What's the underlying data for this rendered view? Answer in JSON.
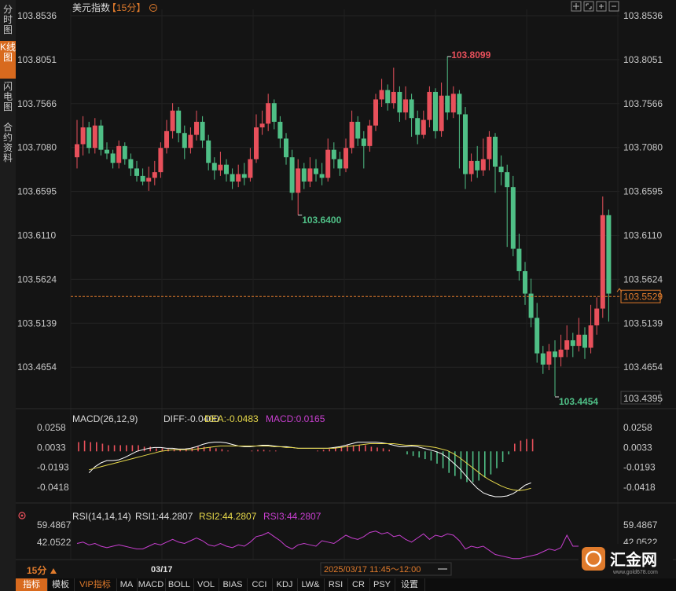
{
  "sidebar": {
    "tabs": [
      {
        "label": "分时图",
        "active": false
      },
      {
        "label": "K线图",
        "active": true
      },
      {
        "label": "闪电图",
        "active": false
      },
      {
        "label": "合约资料",
        "active": false
      }
    ]
  },
  "header": {
    "title": "美元指数",
    "period": "【15分】",
    "toolbar_icons": [
      "crosshair-icon",
      "expand-icon",
      "zoom-in-icon",
      "zoom-out-icon"
    ]
  },
  "price_axis": {
    "labels": [
      "103.8536",
      "103.8051",
      "103.7566",
      "103.7080",
      "103.6595",
      "103.6110",
      "103.5624",
      "103.5139",
      "103.4654"
    ],
    "current_price": "103.5529",
    "low_price_box": "103.4395"
  },
  "annotations": {
    "high": "103.8099",
    "low_mid": "103.6400",
    "low": "103.4454"
  },
  "macd": {
    "label": "MACD(26,12,9)",
    "diff": "DIFF:-0.0400",
    "dea": "DEA:-0.0483",
    "macd": "MACD:0.0165",
    "axis": [
      "0.0258",
      "0.0033",
      "-0.0193",
      "-0.0418"
    ]
  },
  "rsi": {
    "label": "RSI(14,14,14)",
    "rsi1": "RSI1:44.2807",
    "rsi2": "RSI2:44.2807",
    "rsi3": "RSI3:44.2807",
    "axis": [
      "59.4867",
      "42.0522"
    ]
  },
  "footer": {
    "period": "15分",
    "date_mark": "03/17",
    "time_range": "2025/03/17 11:45～12:00"
  },
  "indicator_tabs": [
    {
      "label": "指标",
      "active": true
    },
    {
      "label": "模板"
    },
    {
      "label": "VIP指标",
      "orange": true
    },
    {
      "label": "MA"
    },
    {
      "label": "MACD"
    },
    {
      "label": "BOLL"
    },
    {
      "label": "VOL"
    },
    {
      "label": "BIAS"
    },
    {
      "label": "CCI"
    },
    {
      "label": "KDJ"
    },
    {
      "label": "LW&"
    },
    {
      "label": "RSI"
    },
    {
      "label": "CR"
    },
    {
      "label": "PSY"
    },
    {
      "label": "设置"
    }
  ],
  "logo": {
    "text": "汇金网",
    "sub": "www.gold678.com"
  },
  "colors": {
    "up": "#e8505b",
    "down": "#4fbf86",
    "accent": "#e07b2c",
    "diff": "#ffffff",
    "dea": "#e6d84a",
    "macd": "#c83fd0",
    "rsi": "#c83fd0"
  },
  "chart_data": {
    "type": "candlestick",
    "candles": [
      [
        103.702,
        103.716,
        103.742,
        103.69
      ],
      [
        103.716,
        103.734,
        103.746,
        103.704
      ],
      [
        103.734,
        103.712,
        103.74,
        103.706
      ],
      [
        103.712,
        103.736,
        103.744,
        103.706
      ],
      [
        103.736,
        103.71,
        103.742,
        103.704
      ],
      [
        103.71,
        103.706,
        103.718,
        103.7
      ],
      [
        103.706,
        103.696,
        103.71,
        103.69
      ],
      [
        103.696,
        103.714,
        103.72,
        103.69
      ],
      [
        103.714,
        103.7,
        103.718,
        103.694
      ],
      [
        103.7,
        103.69,
        103.706,
        103.682
      ],
      [
        103.69,
        103.682,
        103.698,
        103.676
      ],
      [
        103.682,
        103.676,
        103.69,
        103.672
      ],
      [
        103.676,
        103.68,
        103.692,
        103.666
      ],
      [
        103.68,
        103.686,
        103.698,
        103.672
      ],
      [
        103.686,
        103.712,
        103.718,
        103.68
      ],
      [
        103.712,
        103.73,
        103.742,
        103.706
      ],
      [
        103.73,
        103.752,
        103.76,
        103.722
      ],
      [
        103.752,
        103.728,
        103.756,
        103.718
      ],
      [
        103.728,
        103.712,
        103.736,
        103.7
      ],
      [
        103.712,
        103.726,
        103.734,
        103.706
      ],
      [
        103.726,
        103.74,
        103.752,
        103.72
      ],
      [
        103.74,
        103.72,
        103.746,
        103.712
      ],
      [
        103.72,
        103.696,
        103.726,
        103.688
      ],
      [
        103.696,
        103.688,
        103.702,
        103.678
      ],
      [
        103.688,
        103.694,
        103.708,
        103.682
      ],
      [
        103.694,
        103.684,
        103.7,
        103.676
      ],
      [
        103.684,
        103.676,
        103.69,
        103.668
      ],
      [
        103.676,
        103.684,
        103.694,
        103.67
      ],
      [
        103.684,
        103.68,
        103.696,
        103.672
      ],
      [
        103.68,
        103.7,
        103.712,
        103.676
      ],
      [
        103.7,
        103.734,
        103.748,
        103.696
      ],
      [
        103.734,
        103.738,
        103.752,
        103.726
      ],
      [
        103.738,
        103.76,
        103.77,
        103.73
      ],
      [
        103.76,
        103.74,
        103.764,
        103.732
      ],
      [
        103.74,
        103.722,
        103.746,
        103.712
      ],
      [
        103.722,
        103.702,
        103.728,
        103.694
      ],
      [
        103.702,
        103.664,
        103.71,
        103.656
      ],
      [
        103.664,
        103.69,
        103.7,
        103.64
      ],
      [
        103.69,
        103.676,
        103.696,
        103.668
      ],
      [
        103.676,
        103.69,
        103.702,
        103.67
      ],
      [
        103.69,
        103.684,
        103.7,
        103.676
      ],
      [
        103.684,
        103.68,
        103.696,
        103.672
      ],
      [
        103.68,
        103.71,
        103.722,
        103.676
      ],
      [
        103.71,
        103.7,
        103.718,
        103.69
      ],
      [
        103.7,
        103.69,
        103.708,
        103.682
      ],
      [
        103.69,
        103.712,
        103.722,
        103.686
      ],
      [
        103.712,
        103.74,
        103.752,
        103.706
      ],
      [
        103.74,
        103.722,
        103.746,
        103.714
      ],
      [
        103.722,
        103.714,
        103.73,
        103.69
      ],
      [
        103.714,
        103.736,
        103.742,
        103.708
      ],
      [
        103.736,
        103.764,
        103.77,
        103.73
      ],
      [
        103.764,
        103.774,
        103.786,
        103.756
      ],
      [
        103.774,
        103.76,
        103.78,
        103.752
      ],
      [
        103.76,
        103.772,
        103.798,
        103.754
      ],
      [
        103.772,
        103.75,
        103.778,
        103.74
      ],
      [
        103.75,
        103.764,
        103.778,
        103.742
      ],
      [
        103.764,
        103.744,
        103.77,
        103.724
      ],
      [
        103.744,
        103.726,
        103.752,
        103.716
      ],
      [
        103.726,
        103.742,
        103.752,
        103.722
      ],
      [
        103.742,
        103.772,
        103.778,
        103.734
      ],
      [
        103.772,
        103.73,
        103.776,
        103.722
      ],
      [
        103.73,
        103.768,
        103.782,
        103.724
      ],
      [
        103.768,
        103.75,
        103.81,
        103.742
      ],
      [
        103.75,
        103.77,
        103.778,
        103.744
      ],
      [
        103.77,
        103.748,
        103.774,
        103.69
      ],
      [
        103.748,
        103.684,
        103.756,
        103.668
      ],
      [
        103.684,
        103.698,
        103.706,
        103.676
      ],
      [
        103.698,
        103.688,
        103.714,
        103.68
      ],
      [
        103.688,
        103.7,
        103.722,
        103.682
      ],
      [
        103.7,
        103.724,
        103.73,
        103.688
      ],
      [
        103.724,
        103.692,
        103.728,
        103.664
      ],
      [
        103.692,
        103.686,
        103.704,
        103.672
      ],
      [
        103.686,
        103.67,
        103.694,
        103.606
      ],
      [
        103.67,
        103.604,
        103.682,
        103.596
      ],
      [
        103.604,
        103.58,
        103.62,
        103.57
      ],
      [
        103.58,
        103.556,
        103.59,
        103.544
      ],
      [
        103.556,
        103.53,
        103.572,
        103.52
      ],
      [
        103.53,
        103.492,
        103.546,
        103.482
      ],
      [
        103.492,
        103.48,
        103.5,
        103.47
      ],
      [
        103.48,
        103.494,
        103.502,
        103.474
      ],
      [
        103.494,
        103.488,
        103.506,
        103.446
      ],
      [
        103.488,
        103.496,
        103.512,
        103.478
      ],
      [
        103.496,
        103.506,
        103.522,
        103.488
      ],
      [
        103.506,
        103.5,
        103.514,
        103.488
      ],
      [
        103.5,
        103.512,
        103.53,
        103.494
      ],
      [
        103.512,
        103.498,
        103.52,
        103.486
      ],
      [
        103.498,
        103.522,
        103.544,
        103.492
      ],
      [
        103.522,
        103.54,
        103.552,
        103.512
      ],
      [
        103.54,
        103.64,
        103.66,
        103.53
      ],
      [
        103.64,
        103.556,
        103.646,
        103.526
      ]
    ],
    "ylim": [
      103.4395,
      103.8536
    ],
    "markers": {
      "high": 103.8099,
      "low_mid": 103.64,
      "low": 103.4454
    },
    "current_price": 103.5529,
    "macd_ylim": [
      -0.06,
      0.032
    ],
    "diff": [
      -0.028,
      -0.02,
      -0.015,
      -0.012,
      -0.012,
      -0.011,
      -0.008,
      -0.004,
      0.0,
      0.002,
      0.004,
      0.005,
      0.005,
      0.004,
      0.004,
      0.003,
      0.003,
      0.004,
      0.006,
      0.009,
      0.011,
      0.012,
      0.012,
      0.011,
      0.009,
      0.007,
      0.006,
      0.006,
      0.007,
      0.008,
      0.008,
      0.007,
      0.006,
      0.006,
      0.005,
      0.004,
      0.004,
      0.004,
      0.004,
      0.004,
      0.004,
      0.005,
      0.006,
      0.008,
      0.01,
      0.012,
      0.012,
      0.012,
      0.012,
      0.011,
      0.01,
      0.008,
      0.006,
      0.006,
      0.007,
      0.006,
      0.004,
      0.002,
      0.0,
      -0.003,
      -0.008,
      -0.015,
      -0.022,
      -0.031,
      -0.04,
      -0.048,
      -0.054,
      -0.057,
      -0.059,
      -0.059,
      -0.058,
      -0.055,
      -0.05,
      -0.044,
      -0.041
    ],
    "dea": [
      -0.024,
      -0.022,
      -0.02,
      -0.018,
      -0.016,
      -0.014,
      -0.012,
      -0.01,
      -0.008,
      -0.006,
      -0.004,
      -0.002,
      0.0,
      0.001,
      0.002,
      0.002,
      0.002,
      0.002,
      0.003,
      0.004,
      0.005,
      0.006,
      0.007,
      0.007,
      0.007,
      0.007,
      0.007,
      0.007,
      0.007,
      0.007,
      0.007,
      0.006,
      0.006,
      0.005,
      0.005,
      0.004,
      0.004,
      0.004,
      0.004,
      0.004,
      0.004,
      0.004,
      0.005,
      0.006,
      0.007,
      0.008,
      0.009,
      0.01,
      0.01,
      0.01,
      0.01,
      0.01,
      0.009,
      0.008,
      0.008,
      0.008,
      0.007,
      0.006,
      0.005,
      0.003,
      0.001,
      -0.003,
      -0.008,
      -0.014,
      -0.02,
      -0.026,
      -0.032,
      -0.037,
      -0.041,
      -0.045,
      -0.048,
      -0.05,
      -0.051,
      -0.05,
      -0.048
    ],
    "macd_hist": [
      0.012,
      0.014,
      0.012,
      0.012,
      0.01,
      0.008,
      0.008,
      0.008,
      0.008,
      0.008,
      0.008,
      0.006,
      0.006,
      0.004,
      0.004,
      0.003,
      0.003,
      0.002,
      0.003,
      0.005,
      0.006,
      0.006,
      0.005,
      0.004,
      0.003,
      0.001,
      0.0,
      0.0,
      0.0,
      0.001,
      0.002,
      0.002,
      0.001,
      0.001,
      0.0,
      0.0,
      0.0,
      0.0,
      0.0,
      0.0,
      0.001,
      0.002,
      0.003,
      0.004,
      0.006,
      0.008,
      0.008,
      0.008,
      0.008,
      0.006,
      0.005,
      0.004,
      0.002,
      0.0,
      0.0,
      -0.004,
      -0.006,
      -0.008,
      -0.01,
      -0.012,
      -0.016,
      -0.022,
      -0.028,
      -0.032,
      -0.036,
      -0.04,
      -0.04,
      -0.038,
      -0.034,
      -0.03,
      -0.022,
      -0.014,
      -0.004,
      0.01,
      0.014,
      0.016,
      0.016
    ],
    "rsi_ylim": [
      32,
      64
    ],
    "rsi": [
      46,
      47,
      45,
      46,
      44,
      43,
      44,
      45,
      44,
      43,
      42,
      42,
      44,
      46,
      45,
      47,
      49,
      47,
      46,
      48,
      50,
      48,
      45,
      44,
      46,
      44,
      43,
      45,
      44,
      47,
      51,
      52,
      54,
      51,
      48,
      44,
      42,
      45,
      46,
      45,
      44,
      48,
      47,
      46,
      49,
      52,
      50,
      49,
      51,
      54,
      55,
      53,
      54,
      51,
      52,
      49,
      47,
      50,
      53,
      49,
      52,
      51,
      53,
      52,
      48,
      42,
      44,
      43,
      44,
      41,
      38,
      37,
      36,
      35,
      35,
      36,
      37,
      38,
      40,
      42,
      41,
      43,
      52,
      44,
      44
    ]
  }
}
